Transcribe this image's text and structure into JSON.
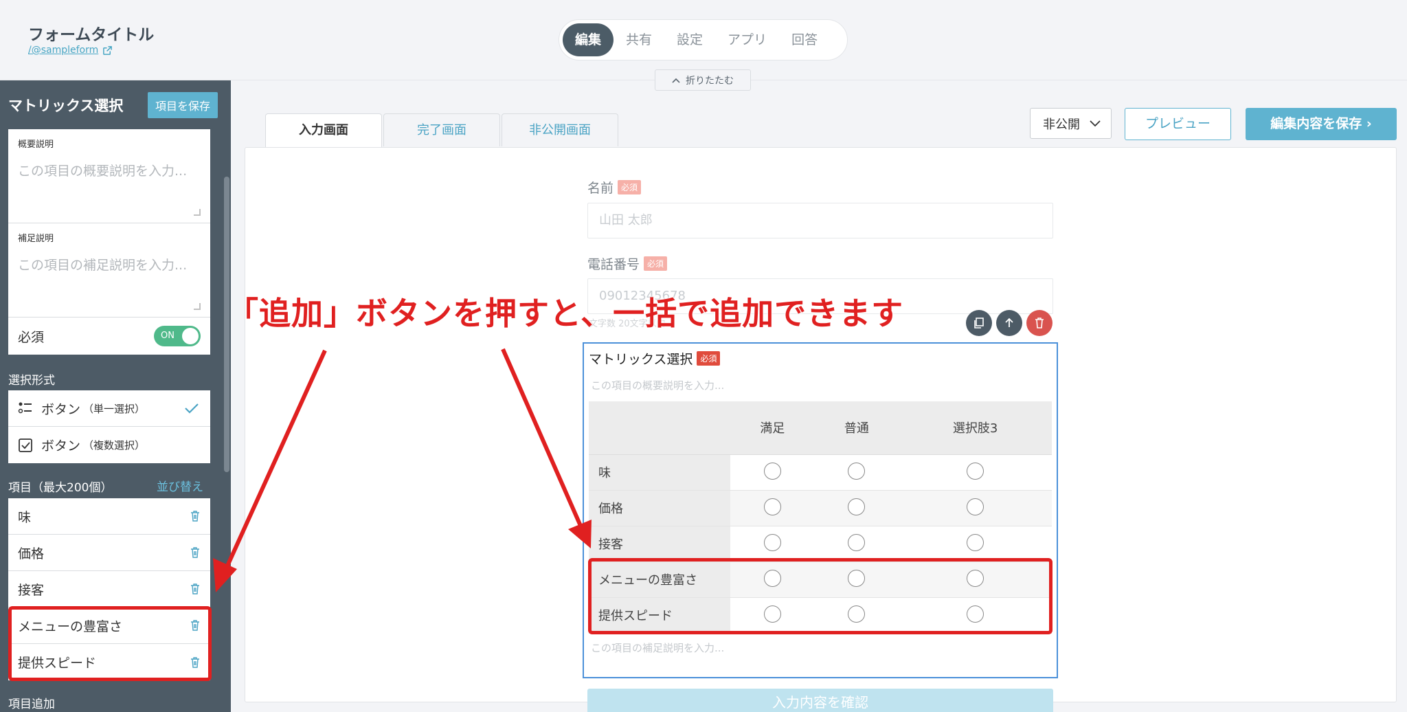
{
  "header": {
    "form_title": "フォームタイトル",
    "form_url": "/@sampleform",
    "tabs": [
      "編集",
      "共有",
      "設定",
      "アプリ",
      "回答"
    ],
    "active_tab": "編集",
    "collapse_label": "折りたたむ"
  },
  "sidebar": {
    "title": "マトリックス選択",
    "save_item_label": "項目を保存",
    "overview_label": "概要説明",
    "overview_placeholder": "この項目の概要説明を入力...",
    "supplement_label": "補足説明",
    "supplement_placeholder": "この項目の補足説明を入力...",
    "required_label": "必須",
    "required_toggle": "ON",
    "selection_format_label": "選択形式",
    "options": [
      {
        "label": "ボタン",
        "sub": "（単一選択）",
        "selected": true
      },
      {
        "label": "ボタン",
        "sub": "（複数選択）",
        "selected": false
      }
    ],
    "items_label": "項目（最大200個）",
    "reorder_label": "並び替え",
    "items": [
      "味",
      "価格",
      "接客",
      "メニューの豊富さ",
      "提供スピード"
    ],
    "add_items_label": "項目追加"
  },
  "content": {
    "tabs": [
      "入力画面",
      "完了画面",
      "非公開画面"
    ],
    "active_tab": "入力画面",
    "visibility_value": "非公開",
    "preview_label": "プレビュー",
    "save_edit_label": "編集内容を保存",
    "name_field": {
      "label": "名前",
      "badge": "必須",
      "placeholder": "山田 太郎"
    },
    "phone_field": {
      "label": "電話番号",
      "badge": "必須",
      "placeholder": "09012345678"
    },
    "char_count": "文字数 20文字以内",
    "matrix": {
      "title": "マトリックス選択",
      "badge": "必須",
      "description_placeholder": "この項目の概要説明を入力...",
      "columns": [
        "満足",
        "普通",
        "選択肢3"
      ],
      "rows": [
        "味",
        "価格",
        "接客",
        "メニューの豊富さ",
        "提供スピード"
      ],
      "supplement_placeholder": "この項目の補足説明を入力..."
    },
    "confirm_label": "入力内容を確認"
  },
  "annotation": {
    "text": "「追加」ボタンを押すと、一括で追加できます",
    "color": "#e02020"
  },
  "colors": {
    "sidebar_bg": "#4d5b66",
    "accent": "#5fb3d0",
    "toggle_on": "#4fb98a",
    "required_badge": "#e04b3c"
  }
}
